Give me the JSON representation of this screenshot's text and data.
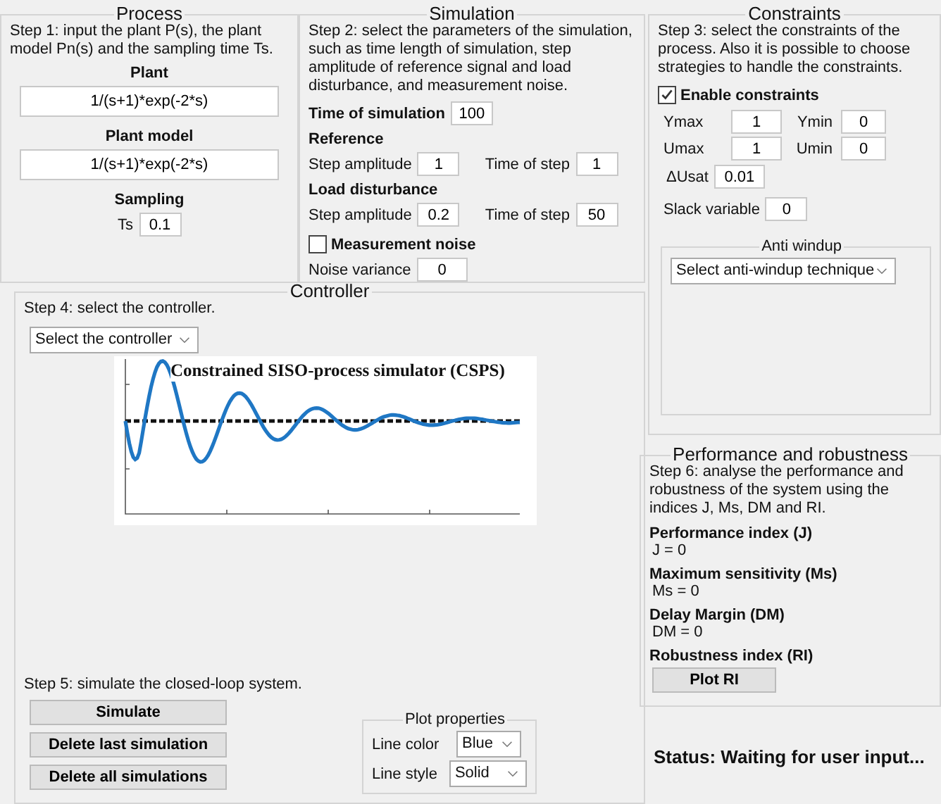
{
  "process": {
    "title": "Process",
    "instructions": "Step 1: input the plant P(s), the plant model Pn(s) and the sampling time Ts.",
    "plant": {
      "label": "Plant",
      "value": "1/(s+1)*exp(-2*s)"
    },
    "plant_model": {
      "label": "Plant model",
      "value": "1/(s+1)*exp(-2*s)"
    },
    "sampling": {
      "label": "Sampling",
      "field_label": "Ts",
      "value": "0.1"
    }
  },
  "simulation": {
    "title": "Simulation",
    "instructions": "Step 2: select the parameters of the simulation, such as time length of simulation, step amplitude of reference  signal and load disturbance, and measurement noise.",
    "time_of_simulation": {
      "label": "Time of simulation",
      "value": "100"
    },
    "groups": [
      {
        "heading": "Reference",
        "fields": [
          {
            "label": "Step amplitude",
            "value": "1"
          },
          {
            "label": "Time of step",
            "value": "1"
          }
        ]
      },
      {
        "heading": "Load disturbance",
        "fields": [
          {
            "label": "Step amplitude",
            "value": "0.2"
          },
          {
            "label": "Time of step",
            "value": "50"
          }
        ]
      }
    ],
    "measurement_noise": {
      "label": "Measurement noise",
      "checked": false
    },
    "noise_variance": {
      "label": "Noise variance",
      "value": "0"
    }
  },
  "constraints": {
    "title": "Constraints",
    "instructions": "Step 3: select the constraints of the process. Also it is possible to choose strategies to handle the constraints.",
    "enable": {
      "label": "Enable constraints",
      "checked": true
    },
    "limits": [
      {
        "label": "Ymax",
        "value": "1"
      },
      {
        "label": "Ymin",
        "value": "0"
      },
      {
        "label": "Umax",
        "value": "1"
      },
      {
        "label": "Umin",
        "value": "0"
      }
    ],
    "delta_usat": {
      "label": "ΔUsat",
      "value": "0.01"
    },
    "slack": {
      "label": "Slack variable",
      "value": "0"
    },
    "anti_windup": {
      "title": "Anti windup",
      "select": "Select anti-windup technique"
    }
  },
  "controller": {
    "title": "Controller",
    "instructions": "Step 4: select the controller.",
    "select": "Select the controller",
    "plot_title": "Constrained SISO-process simulator (CSPS)",
    "step5": "Step 5: simulate the closed-loop system.",
    "buttons": [
      "Simulate",
      "Delete last simulation",
      "Delete all simulations"
    ],
    "plot_properties": {
      "title": "Plot properties",
      "rows": [
        {
          "label": "Line color",
          "value": "Blue"
        },
        {
          "label": "Line style",
          "value": "Solid"
        }
      ]
    }
  },
  "performance": {
    "title": "Performance and robustness",
    "instructions": "Step 6: analyse the performance and robustness of the system using the indices J, Ms, DM and RI.",
    "indices": [
      {
        "heading": "Performance index (J)",
        "kind": "value",
        "text": "J = 0"
      },
      {
        "heading": "Maximum sensitivity (Ms)",
        "kind": "value",
        "text": "Ms = 0"
      },
      {
        "heading": "Delay Margin (DM)",
        "kind": "value",
        "text": "DM = 0"
      },
      {
        "heading": "Robustness index (RI)",
        "kind": "button",
        "text": "Plot RI"
      }
    ]
  },
  "status": "Status: Waiting for user input..."
}
